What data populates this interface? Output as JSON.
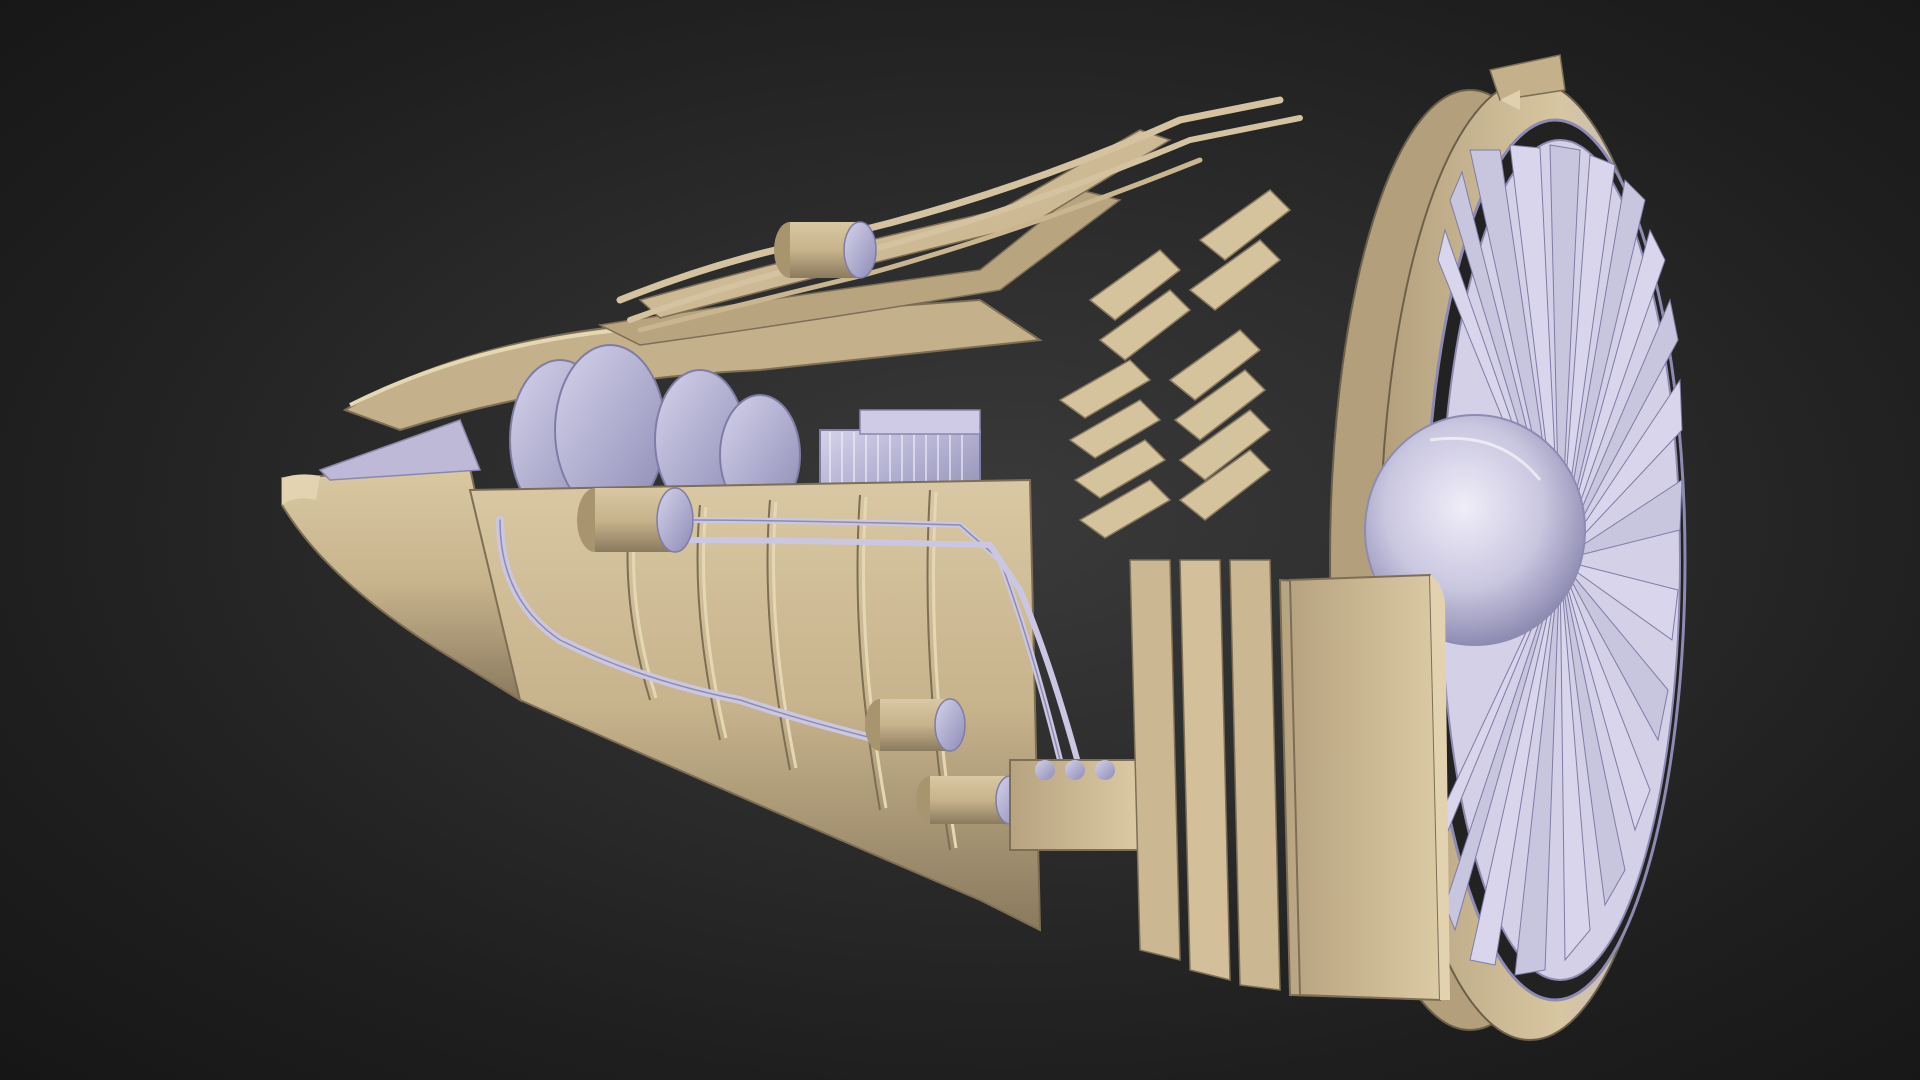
{
  "scene": {
    "subject": "turbofan-engine-cutaway-model",
    "colors": {
      "background_center": "#3a3a3a",
      "background_edge": "#161616",
      "model_tan": "#c9b58f",
      "model_tan_dark": "#8f7f62",
      "model_lilac": "#b9b6d6",
      "model_lilac_dark": "#8e8bb3",
      "shadow": "#4a4238"
    }
  }
}
